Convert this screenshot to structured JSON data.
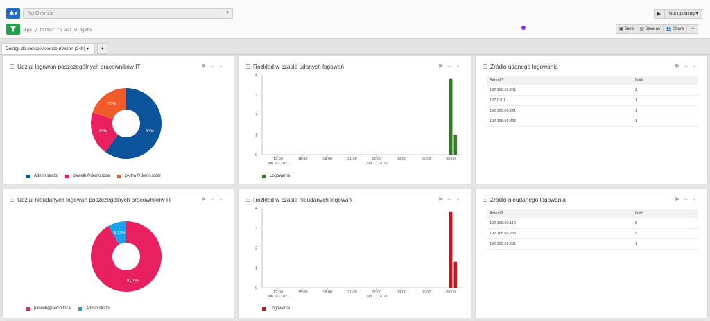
{
  "toolbar": {
    "override_placeholder": "No Override",
    "filter_placeholder": "Apply filter to all widgets",
    "not_updating": "Not updating",
    "save": "Save",
    "save_as": "Save as",
    "share": "Share",
    "more": "•••"
  },
  "tabs": [
    {
      "label": "Dostęp do konsoli Axence nVision (24h)"
    }
  ],
  "tab_add_label": "+",
  "panels": {
    "pie_success_title": "Udział logowań poszczególnych pracowników IT",
    "bar_success_title": "Rozkład w czasie udanych logowań",
    "table_success_title": "Źródło udanego logowania",
    "pie_fail_title": "Udział nieudanych logowań poszczególnych pracowników IT",
    "bar_fail_title": "Rozkład w czasie nieudanych logowań",
    "table_fail_title": "Źródło nieudanego logowania"
  },
  "tables": {
    "success": {
      "headers": [
        "AdresIP",
        "Ilość"
      ],
      "rows": [
        [
          "192.168.69.251",
          "2"
        ],
        [
          "127.0.0.1",
          "1"
        ],
        [
          "192.168.60.221",
          "1"
        ],
        [
          "192.168.60.235",
          "1"
        ]
      ]
    },
    "fail": {
      "headers": [
        "AdresIP",
        "Ilość"
      ],
      "rows": [
        [
          "192.168.60.110",
          "8"
        ],
        [
          "192.168.60.235",
          "3"
        ],
        [
          "192.168.69.251",
          "1"
        ]
      ]
    }
  },
  "colors": {
    "blue": "#0b539b",
    "pink": "#e8205f",
    "orange": "#f15a29",
    "cyan": "#1aa3e8",
    "green": "#2e7d1e",
    "red": "#c4161c"
  },
  "chart_data": [
    {
      "type": "pie",
      "donut": true,
      "slices": [
        {
          "name": "Administrator",
          "value": 60,
          "label": "60%",
          "color": "#0b539b"
        },
        {
          "name": "pawelb@demo.local",
          "value": 20,
          "label": "20%",
          "color": "#e8205f"
        },
        {
          "name": "piotrw@demo.local",
          "value": 20,
          "label": "20%",
          "color": "#f15a29"
        }
      ],
      "legend": "bottom"
    },
    {
      "type": "bar",
      "x_ticks": [
        {
          "label": "12:00",
          "sub": "Jun 16, 2021"
        },
        {
          "label": "15:00"
        },
        {
          "label": "18:00"
        },
        {
          "label": "21:00"
        },
        {
          "label": "00:00",
          "sub": "Jun 17, 2021"
        },
        {
          "label": "03:00"
        },
        {
          "label": "06:00"
        },
        {
          "label": "09:00"
        }
      ],
      "y_ticks": [
        "0",
        "1",
        "2",
        "3",
        "4"
      ],
      "ylim": [
        0,
        4
      ],
      "bars": [
        {
          "x": "09:00",
          "value": 3.8
        },
        {
          "x": "09:15",
          "value": 1.0
        }
      ],
      "series": [
        {
          "name": "Logowania",
          "color": "#2e7d1e"
        }
      ],
      "legend": "bottom"
    },
    {
      "type": "pie",
      "donut": true,
      "slices": [
        {
          "name": "pawelb@demo.local",
          "value": 91.7,
          "label": "91.7%",
          "color": "#e8205f"
        },
        {
          "name": "Administrator",
          "value": 8.33,
          "label": "8.33%",
          "color": "#1aa3e8"
        }
      ],
      "legend": "bottom"
    },
    {
      "type": "bar",
      "x_ticks": [
        {
          "label": "12:00",
          "sub": "Jun 16, 2021"
        },
        {
          "label": "15:00"
        },
        {
          "label": "18:00"
        },
        {
          "label": "21:00"
        },
        {
          "label": "00:00",
          "sub": "Jun 17, 2021"
        },
        {
          "label": "03:00"
        },
        {
          "label": "06:00"
        },
        {
          "label": "09:00"
        }
      ],
      "y_ticks": [
        "0",
        "1",
        "2",
        "3",
        "4"
      ],
      "ylim": [
        0,
        4
      ],
      "bars": [
        {
          "x": "09:00",
          "value": 3.8
        },
        {
          "x": "09:15",
          "value": 1.3
        }
      ],
      "series": [
        {
          "name": "Logowania",
          "color": "#c4161c"
        }
      ],
      "legend": "bottom"
    }
  ]
}
